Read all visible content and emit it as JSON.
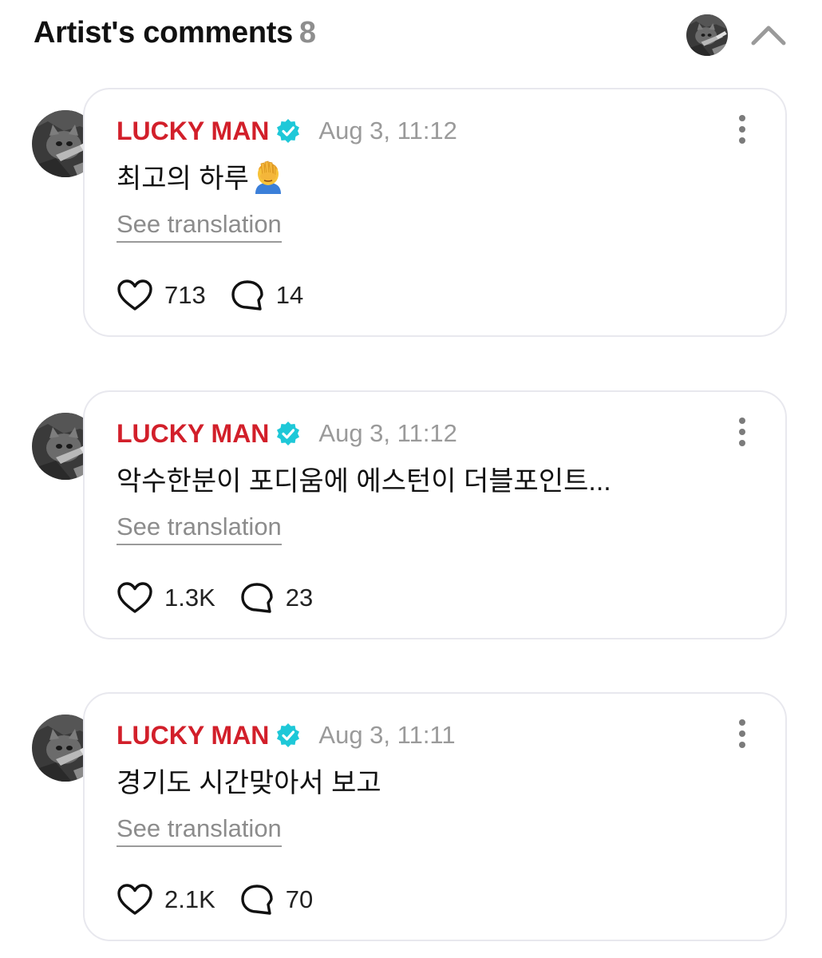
{
  "header": {
    "title": "Artist's comments",
    "count": "8",
    "avatar_icon": "cat-guitar-avatar",
    "collapse_icon": "chevron-up-icon"
  },
  "colors": {
    "author": "#d21f2a",
    "verified": "#1ec8d8",
    "muted": "#9a9a9a",
    "card_border": "#e8e8ee"
  },
  "comments": [
    {
      "author": "LUCKY MAN",
      "timestamp": "Aug 3, 11:12",
      "text": "최고의 하루",
      "emoji": "face-palm-emoji",
      "translate_label": "See translation",
      "likes": "713",
      "replies": "14"
    },
    {
      "author": "LUCKY MAN",
      "timestamp": "Aug 3, 11:12",
      "text": "악수한분이 포디움에 에스턴이 더블포인트...",
      "translate_label": "See translation",
      "likes": "1.3K",
      "replies": "23"
    },
    {
      "author": "LUCKY MAN",
      "timestamp": "Aug 3, 11:11",
      "text": "경기도 시간맞아서 보고",
      "translate_label": "See translation",
      "likes": "2.1K",
      "replies": "70"
    }
  ]
}
